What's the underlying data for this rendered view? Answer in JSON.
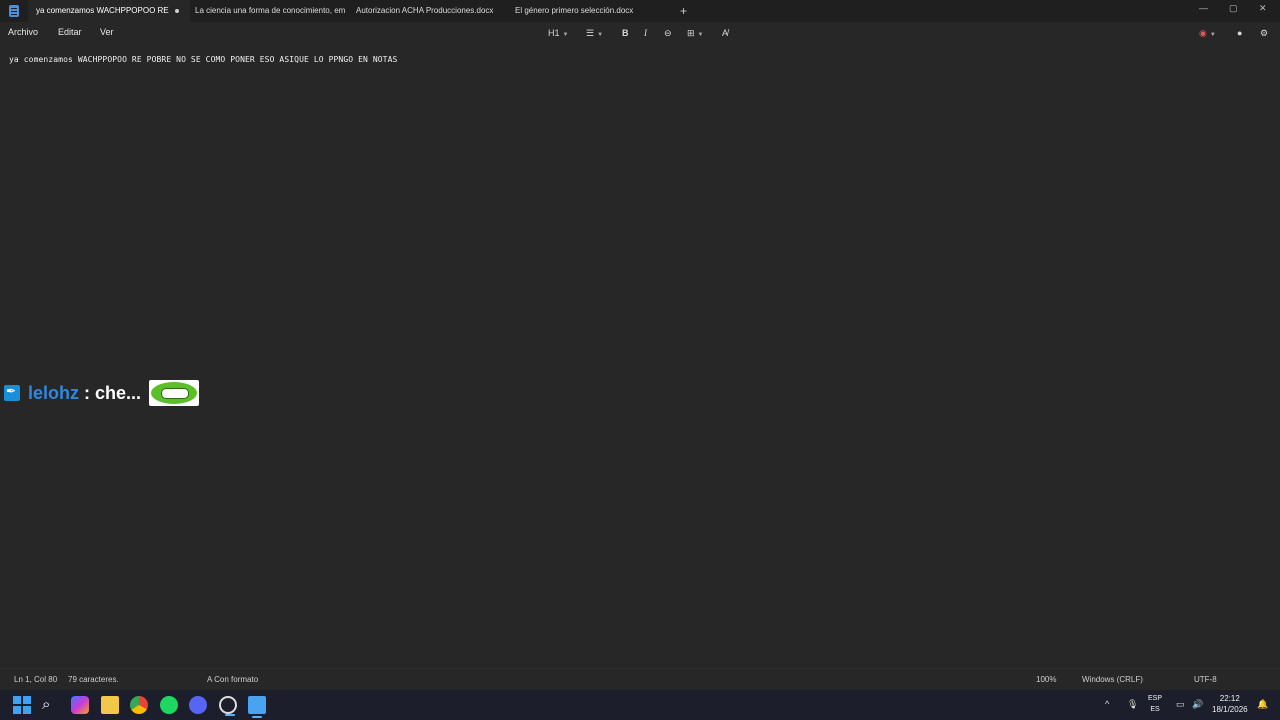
{
  "tabs": [
    {
      "label": "ya comenzamos WACHPPOPOO RE",
      "active": true,
      "unsaved": true
    },
    {
      "label": "La ciencia una forma de conocimiento, em",
      "active": false
    },
    {
      "label": "Autorizacion ACHA Producciones.docx",
      "active": false
    },
    {
      "label": "El género primero selección.docx",
      "active": false
    }
  ],
  "menu": {
    "archivo": "Archivo",
    "editar": "Editar",
    "ver": "Ver"
  },
  "toolbar": {
    "heading": "H1",
    "bold": "B",
    "italic": "I"
  },
  "document": {
    "text": "ya comenzamos WACHPPOPOO RE POBRE NO SE COMO PONER ESO ASIQUE LO PPNGO EN NOTAS"
  },
  "chat_overlay": {
    "username": "lelohz",
    "message": ": che...",
    "emote": "green-grin-emote"
  },
  "status": {
    "position": "Ln 1, Col 80",
    "chars": "79 caracteres.",
    "format": "Con formato",
    "zoom": "100%",
    "line_ending": "Windows (CRLF)",
    "encoding": "UTF-8"
  },
  "taskbar": {
    "lang_top": "ESP",
    "lang_bottom": "ES",
    "time": "22:12",
    "date": "18/1/2026"
  },
  "colors": {
    "accent": "#2f88e0",
    "background": "#272727",
    "taskbar": "#1c1f2b"
  }
}
